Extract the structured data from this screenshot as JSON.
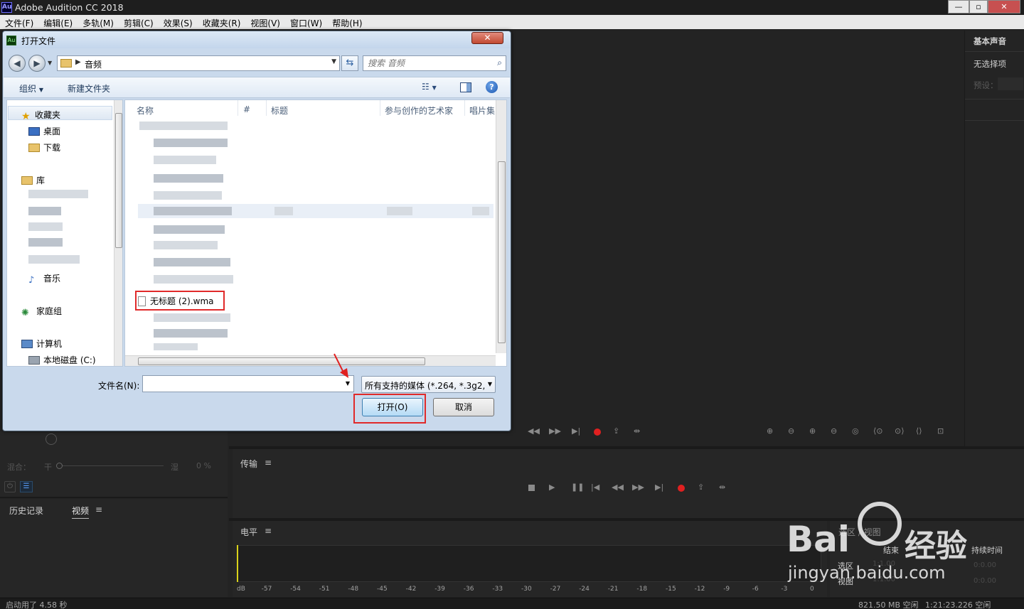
{
  "app": {
    "title": "Adobe Audition CC 2018",
    "icon_text": "Au",
    "window_buttons": [
      "—",
      "▫",
      "✕"
    ]
  },
  "menubar": [
    "文件(F)",
    "编辑(E)",
    "多轨(M)",
    "剪辑(C)",
    "效果(S)",
    "收藏夹(R)",
    "视图(V)",
    "窗口(W)",
    "帮助(H)"
  ],
  "right_panel": {
    "title": "基本声音",
    "no_selection": "无选择项",
    "preset_label": "预设："
  },
  "left_panels": {
    "mix_label": "混合：",
    "dry_label": "干",
    "wet_label": "湿",
    "mix_value": "0 %",
    "history_tab": "历史记录",
    "video_tab": "视频",
    "menu_glyph": "≡"
  },
  "transport_panel": {
    "title": "传输",
    "menu_glyph": "≡"
  },
  "level_panel": {
    "title": "电平",
    "menu_glyph": "≡",
    "scale": [
      "dB",
      "-57",
      "-54",
      "-51",
      "-48",
      "-45",
      "-42",
      "-39",
      "-36",
      "-33",
      "-30",
      "-27",
      "-24",
      "-21",
      "-18",
      "-15",
      "-12",
      "-9",
      "-6",
      "-3",
      "0"
    ]
  },
  "selection_panel": {
    "title": "选区 / 视图",
    "col_end": "结束",
    "col_duration": "持续时间",
    "row_selection": "选区",
    "row_view": "视图",
    "sel_end": "1:1.00",
    "sel_dur": "0:0.00",
    "view_end": "1:1.00",
    "view_dur": "0:0.00"
  },
  "status_bar": {
    "startup": "启动用了 4.58 秒",
    "free_space": "821.50 MB 空闲",
    "free_time": "1:21:23.226 空闲"
  },
  "watermark": {
    "brand": "Bai",
    "brand2": "经验",
    "url": "jingyan.baidu.com"
  },
  "dialog": {
    "title": "打开文件",
    "icon_text": "Au",
    "close": "✕",
    "address_path": "音频",
    "search_placeholder": "搜索 音频",
    "toolbar_organize": "组织",
    "toolbar_new_folder": "新建文件夹",
    "nav": {
      "favorites": "收藏夹",
      "desktop": "桌面",
      "downloads": "下载",
      "libraries": "库",
      "music": "音乐",
      "homegroup": "家庭组",
      "computer": "计算机",
      "local_disk": "本地磁盘 (C:)"
    },
    "columns": [
      "名称",
      "#",
      "标题",
      "参与创作的艺术家",
      "唱片集"
    ],
    "highlighted_file": "无标题 (2).wma",
    "filename_label": "文件名(N):",
    "filename_value": "",
    "filter_value": "所有支持的媒体 (*.264, *.3g2,",
    "open_button": "打开(O)",
    "cancel_button": "取消"
  }
}
